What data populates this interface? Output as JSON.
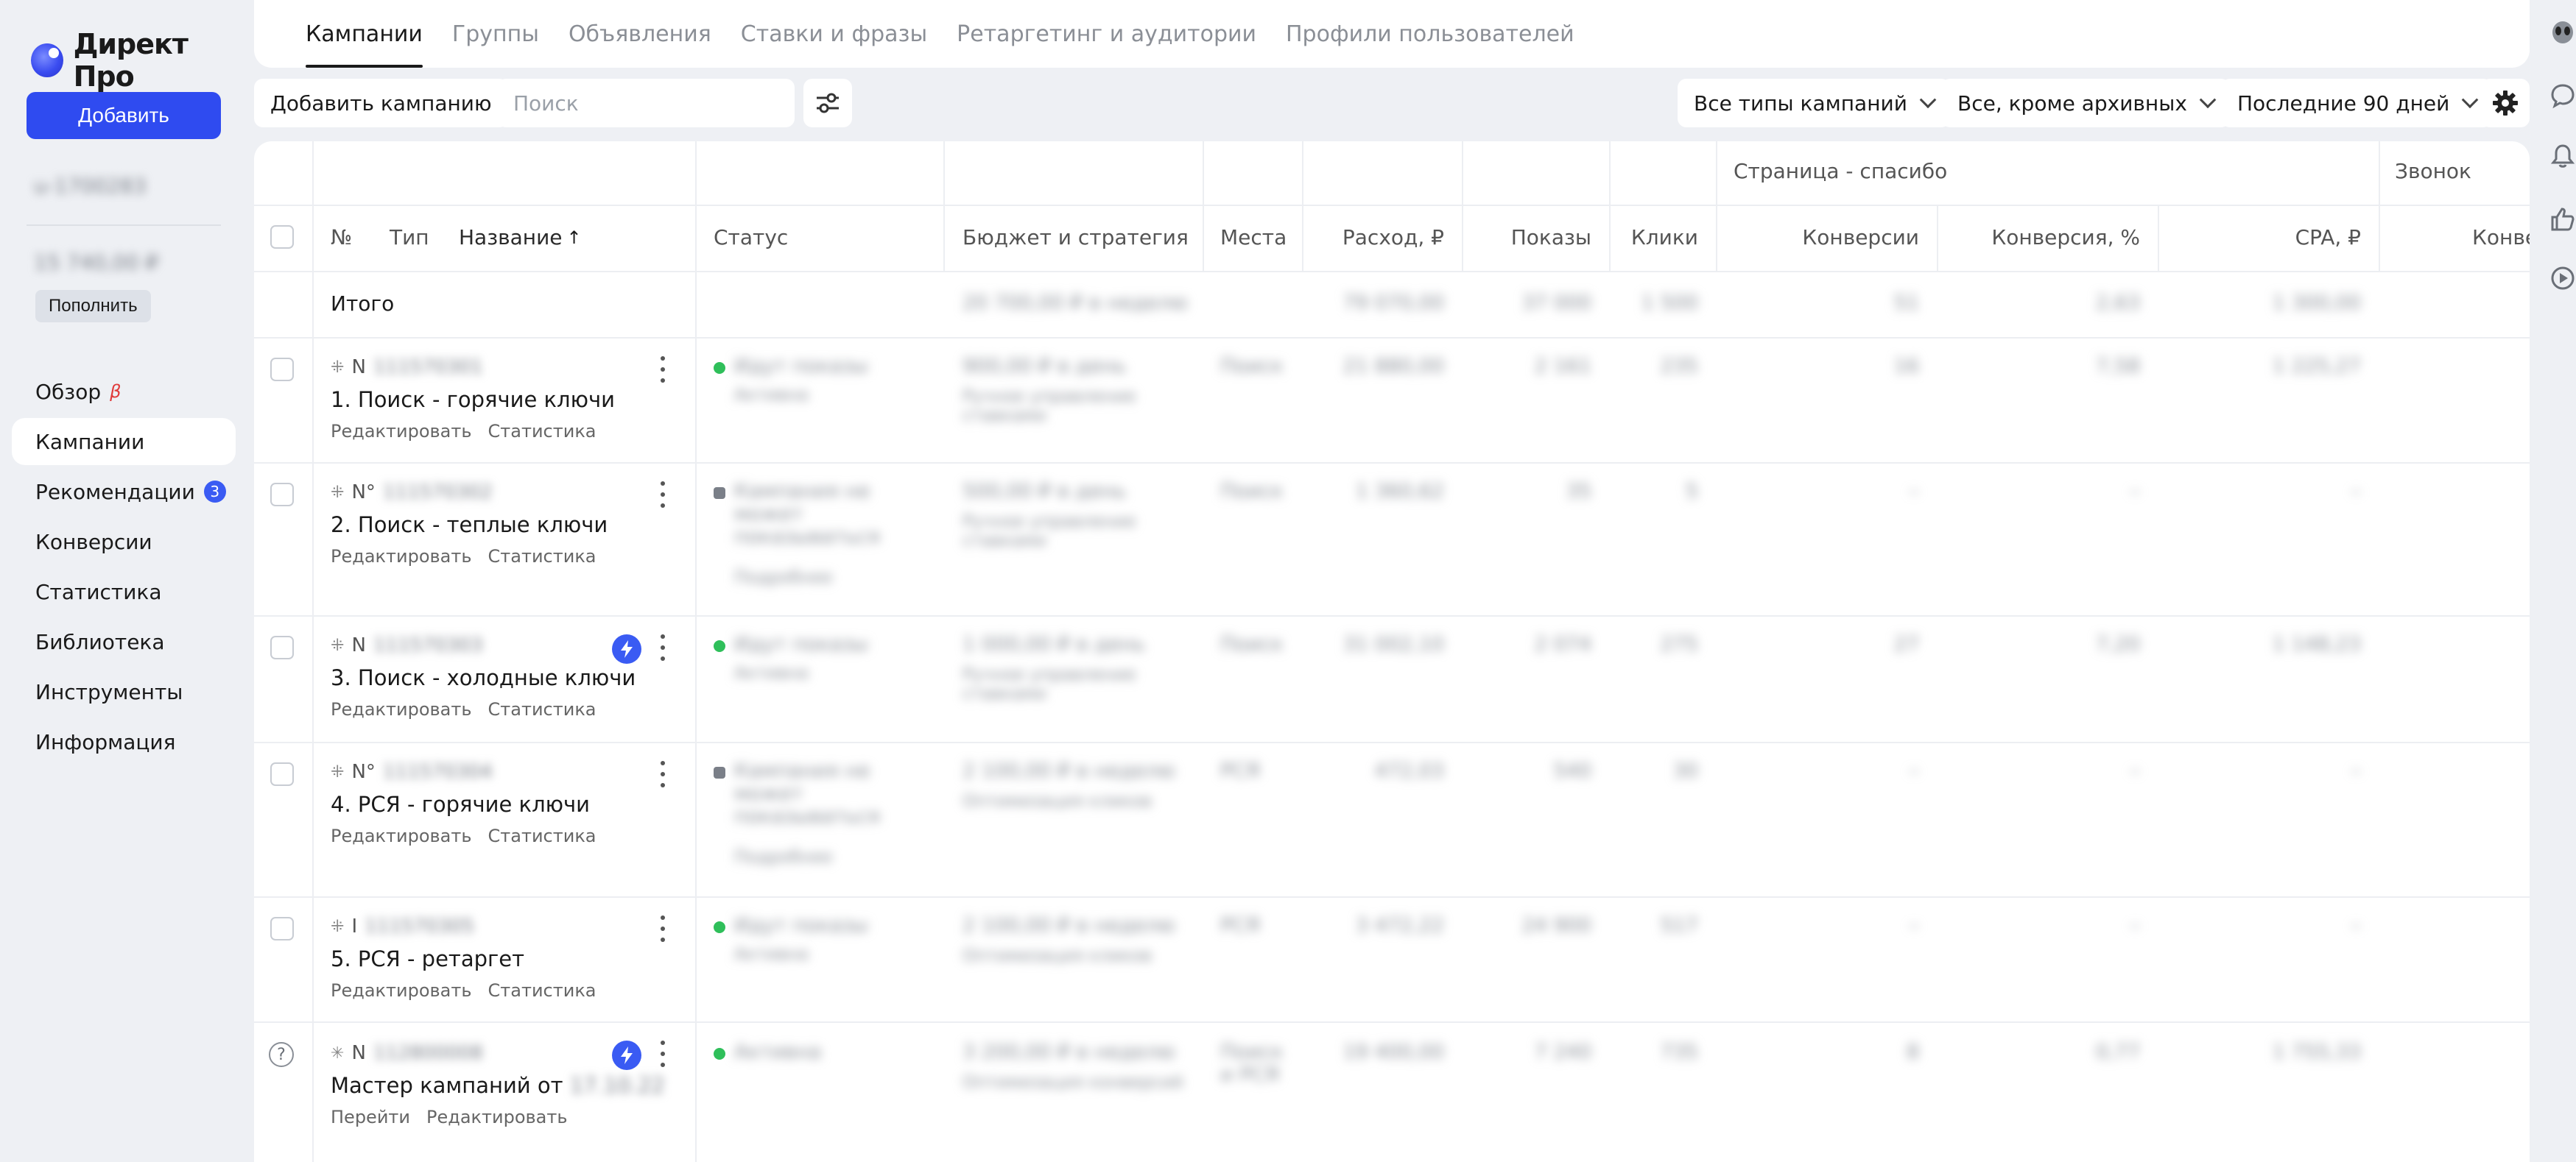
{
  "app": {
    "logo_text": "Директ Про"
  },
  "sidebar": {
    "add_label": "Добавить",
    "login": "u-1700283",
    "balance": "15 740,00 ₽",
    "topup_label": "Пополнить",
    "nav": [
      {
        "label": "Обзор",
        "beta": "β"
      },
      {
        "label": "Кампании",
        "active": true
      },
      {
        "label": "Рекомендации",
        "badge": "3"
      },
      {
        "label": "Конверсии"
      },
      {
        "label": "Статистика"
      },
      {
        "label": "Библиотека"
      },
      {
        "label": "Инструменты"
      },
      {
        "label": "Информация"
      }
    ]
  },
  "tabs": [
    "Кампании",
    "Группы",
    "Объявления",
    "Ставки и фразы",
    "Ретаргетинг и аудитории",
    "Профили пользователей"
  ],
  "toolbar": {
    "add_campaign_label": "Добавить кампанию",
    "search_placeholder": "Поиск",
    "filter_type": "Все типы кампаний",
    "filter_state": "Все, кроме архивных",
    "filter_period": "Последние 90 дней"
  },
  "table": {
    "group_headers": {
      "thanks_page": "Страница - спасибо",
      "call": "Звонок"
    },
    "columns": {
      "num": "№",
      "type": "Тип",
      "name": "Название",
      "status": "Статус",
      "budget": "Бюджет и стратегия",
      "places": "Места",
      "spend": "Расход, ₽",
      "shows": "Показы",
      "clicks": "Клики",
      "conversions": "Конверсии",
      "conv_rate": "Конверсия, %",
      "cpa": "CPA, ₽",
      "conv2": "Конве"
    },
    "totals_label": "Итого",
    "totals": {
      "budget": "20 700,00 ₽ в неделю",
      "spend": "79 070,00",
      "shows": "37 000",
      "clicks": "1 500",
      "conversions": "51",
      "conv_rate": "2,63",
      "cpa": "1 300,00"
    },
    "rows": [
      {
        "id_prefix": "N",
        "id_blur": "111570301",
        "name": "1. Поиск - горячие ключи",
        "links": [
          "Редактировать",
          "Статистика"
        ],
        "status": "Идут показы",
        "status_sub": "Активна",
        "budget": "900,00 ₽ в день",
        "budget_sub": "Ручное управление ставками",
        "places": "Поиск",
        "spend": "21 880,00",
        "shows": "2 161",
        "clicks": "235",
        "conversions": "16",
        "conv_rate": "7,58",
        "cpa": "1 225,27",
        "status_color": "#2fbf5a",
        "bolt": false
      },
      {
        "id_prefix": "N°",
        "id_blur": "111570302",
        "name": "2. Поиск - теплые ключи",
        "links": [
          "Редактировать",
          "Статистика"
        ],
        "status": "Кампания не может показываться",
        "status_sub": "Подробнее",
        "budget": "500,00 ₽ в день",
        "budget_sub": "Ручное управление ставками",
        "places": "Поиск",
        "spend": "1 360,62",
        "shows": "35",
        "clicks": "5",
        "conversions": "–",
        "conv_rate": "–",
        "cpa": "–",
        "status_color": "#7a7f88",
        "bolt": false
      },
      {
        "id_prefix": "N",
        "id_blur": "111570303",
        "name": "3. Поиск - холодные ключи",
        "links": [
          "Редактировать",
          "Статистика"
        ],
        "status": "Идут показы",
        "status_sub": "Активна",
        "budget": "1 000,00 ₽ в день",
        "budget_sub": "Ручное управление ставками",
        "places": "Поиск",
        "spend": "31 002,10",
        "shows": "2 074",
        "clicks": "275",
        "conversions": "27",
        "conv_rate": "7,20",
        "cpa": "1 148,23",
        "status_color": "#2fbf5a",
        "bolt": true
      },
      {
        "id_prefix": "N°",
        "id_blur": "111570304",
        "name": "4. РСЯ - горячие ключи",
        "links": [
          "Редактировать",
          "Статистика"
        ],
        "status": "Кампания не может показываться",
        "status_sub": "Подробнее",
        "budget": "2 100,00 ₽ в неделю",
        "budget_sub": "Оптимизация кликов",
        "places": "РСЯ",
        "spend": "472,03",
        "shows": "540",
        "clicks": "30",
        "conversions": "–",
        "conv_rate": "–",
        "cpa": "–",
        "status_color": "#7a7f88",
        "bolt": false
      },
      {
        "id_prefix": "I",
        "id_blur": "111570305",
        "name": "5. РСЯ - ретаргет",
        "links": [
          "Редактировать",
          "Статистика"
        ],
        "status": "Идут показы",
        "status_sub": "Активна",
        "budget": "2 100,00 ₽ в неделю",
        "budget_sub": "Оптимизация кликов",
        "places": "РСЯ",
        "spend": "3 472,22",
        "shows": "24 900",
        "clicks": "517",
        "conversions": "–",
        "conv_rate": "–",
        "cpa": "–",
        "status_color": "#2fbf5a",
        "bolt": false
      },
      {
        "id_prefix": "N",
        "id_blur": "112800008",
        "name": "Мастер кампаний от",
        "name_blur": "17.10.22",
        "links": [
          "Перейти",
          "Редактировать"
        ],
        "status": "Активна",
        "status_sub": "",
        "budget": "3 200,00 ₽ в неделю",
        "budget_sub": "Оптимизация конверсий",
        "places": "Поиск и РСЯ",
        "spend": "19 400,00",
        "shows": "7 240",
        "clicks": "735",
        "conversions": "8",
        "conv_rate": "0,77",
        "cpa": "1 755,33",
        "status_color": "#2fbf5a",
        "bolt": true
      }
    ]
  }
}
